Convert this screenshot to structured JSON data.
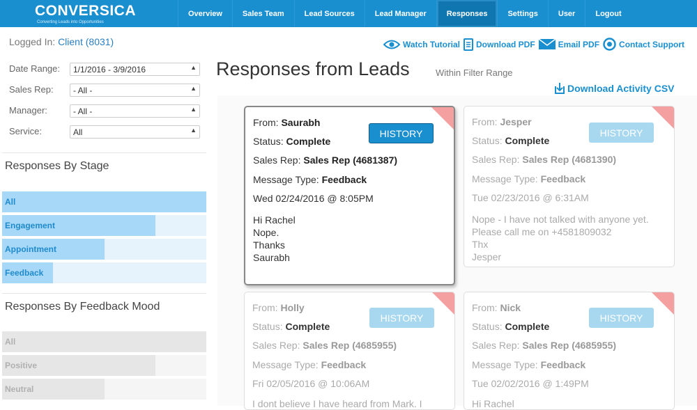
{
  "app": {
    "brand": "CONVERSICA",
    "tagline": "Converting Leads into Opportunities"
  },
  "nav": [
    {
      "label": "Overview"
    },
    {
      "label": "Sales Team"
    },
    {
      "label": "Lead Sources"
    },
    {
      "label": "Lead Manager"
    },
    {
      "label": "Responses",
      "active": true
    },
    {
      "label": "Settings"
    },
    {
      "label": "User"
    },
    {
      "label": "Logout"
    }
  ],
  "header": {
    "logged_in_label": "Logged In:",
    "client": "Client (8031)",
    "actions": {
      "watch_tutorial": "Watch Tutorial",
      "download_pdf": "Download PDF",
      "email_pdf": "Email PDF",
      "contact_support": "Contact Support"
    }
  },
  "filters": [
    {
      "label": "Date Range:",
      "value": "1/1/2016 - 3/9/2016"
    },
    {
      "label": "Sales Rep:",
      "value": "- All -"
    },
    {
      "label": "Manager:",
      "value": "- All -"
    },
    {
      "label": "Service:",
      "value": "All"
    }
  ],
  "by_stage": {
    "title": "Responses By Stage",
    "items": [
      {
        "label": "All",
        "fraction": 1.0
      },
      {
        "label": "Engagement",
        "fraction": 0.75
      },
      {
        "label": "Appointment",
        "fraction": 0.5
      },
      {
        "label": "Feedback",
        "fraction": 0.25
      }
    ]
  },
  "by_mood": {
    "title": "Responses By Feedback Mood",
    "items": [
      {
        "label": "All",
        "fraction": 1.0
      },
      {
        "label": "Positive",
        "fraction": 0.75
      },
      {
        "label": "Neutral",
        "fraction": 0.5
      }
    ]
  },
  "main": {
    "title": "Responses from Leads",
    "subtitle": "Within Filter Range",
    "csv_label": "Download Activity CSV"
  },
  "labels": {
    "from": "From:",
    "status": "Status:",
    "sales_rep": "Sales Rep:",
    "message_type": "Message Type:",
    "history": "HISTORY"
  },
  "cards": [
    {
      "from": "Saurabh",
      "status": "Complete",
      "sales_rep": "Sales Rep (4681387)",
      "message_type": "Feedback",
      "datetime": "Wed 02/24/2016 @ 8:05PM",
      "message": "Hi Rachel\nNope.\nThanks\nSaurabh"
    },
    {
      "from": "Jesper",
      "status": "Complete",
      "sales_rep": "Sales Rep (4681390)",
      "message_type": "Feedback",
      "datetime": "Tue 02/23/2016 @ 6:31AM",
      "message": "Nope - I have not talked with anyone yet. Please call me on +4581809032\nThx\nJesper"
    },
    {
      "from": "Holly",
      "status": "Complete",
      "sales_rep": "Sales Rep (4685955)",
      "message_type": "Feedback",
      "datetime": "Fri 02/05/2016 @ 10:06AM",
      "message": "I dont believe I have heard from Mark. I"
    },
    {
      "from": "Nick",
      "status": "Complete",
      "sales_rep": "Sales Rep (4685955)",
      "message_type": "Feedback",
      "datetime": "Tue 02/02/2016 @ 1:49PM",
      "message": "Hi Rachel"
    }
  ]
}
